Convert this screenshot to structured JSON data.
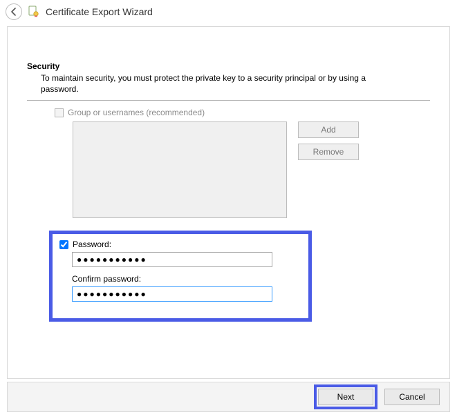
{
  "title": "Certificate Export Wizard",
  "section": {
    "heading": "Security",
    "description": "To maintain security, you must protect the private key to a security principal or by using a password."
  },
  "group": {
    "checkbox_label": "Group or usernames (recommended)",
    "checked": false,
    "add_label": "Add",
    "remove_label": "Remove"
  },
  "password": {
    "checkbox_label": "Password:",
    "checked": true,
    "value": "●●●●●●●●●●●",
    "confirm_label": "Confirm password:",
    "confirm_value": "●●●●●●●●●●●"
  },
  "footer": {
    "next_label": "Next",
    "cancel_label": "Cancel"
  }
}
